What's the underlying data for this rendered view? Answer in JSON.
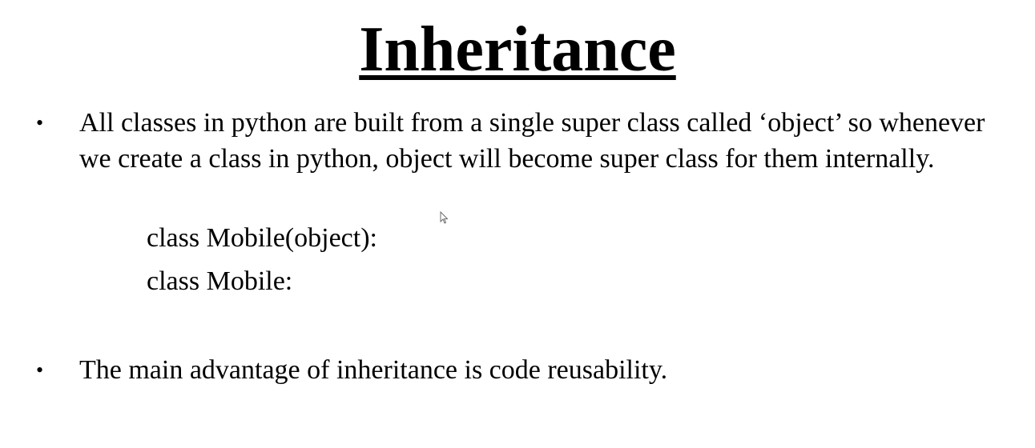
{
  "slide": {
    "title": "Inheritance",
    "bullets": [
      {
        "text": "All classes in python are built from a single super class called ‘object’ so whenever we create a class in python, object will become super class for them internally."
      },
      {
        "text": "The main advantage of inheritance is code reusability."
      }
    ],
    "bullet_symbol": "•",
    "code_examples": [
      "class Mobile(object):",
      "class Mobile:"
    ]
  },
  "icons": {
    "cursor": "mouse-pointer-icon"
  }
}
